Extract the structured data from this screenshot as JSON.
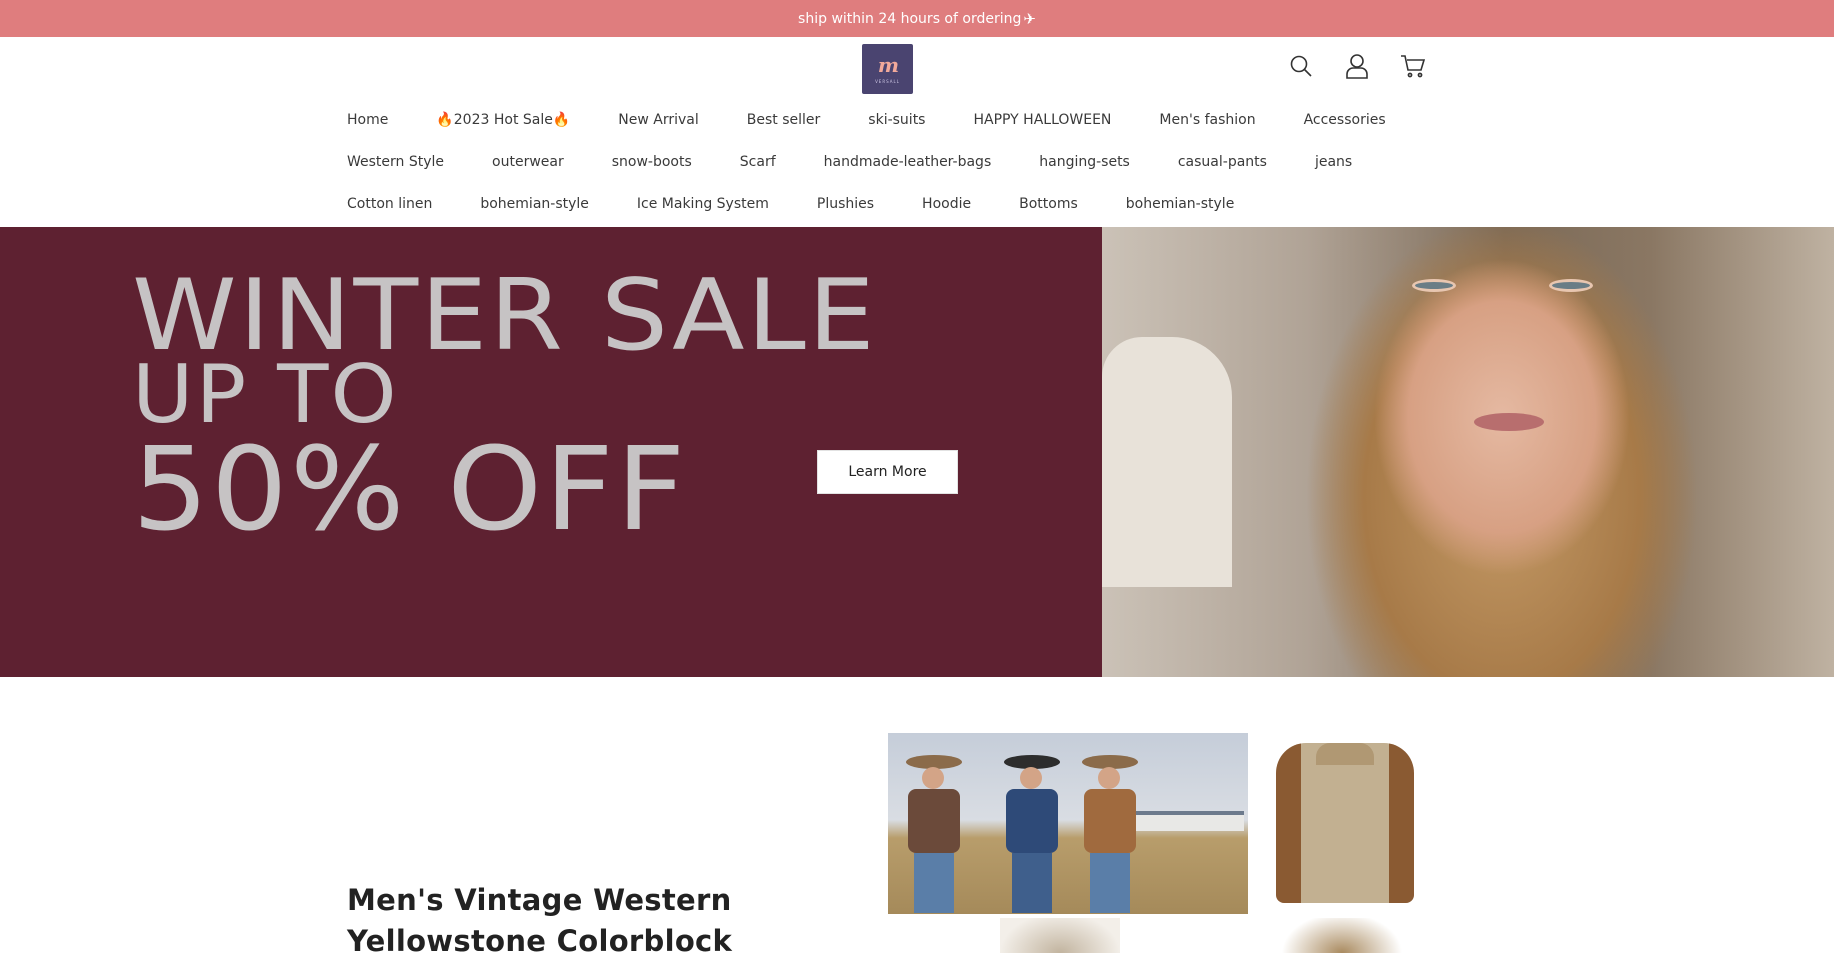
{
  "announcement": {
    "text": "ship within 24 hours of ordering",
    "icon": "✈"
  },
  "logo": {
    "mark": "m",
    "small_text": "VERSALL"
  },
  "header_icons": [
    "search-icon",
    "account-icon",
    "cart-icon"
  ],
  "nav": {
    "row1": [
      "Home",
      "🔥2023 Hot Sale🔥",
      "New Arrival",
      "Best seller",
      "ski-suits",
      "HAPPY HALLOWEEN",
      "Men's fashion",
      "Accessories"
    ],
    "row2": [
      "Western Style",
      "outerwear",
      "snow-boots",
      "Scarf",
      "handmade-leather-bags",
      "hanging-sets",
      "casual-pants",
      "jeans"
    ],
    "row3": [
      "Cotton linen",
      "bohemian-style",
      "Ice Making System",
      "Plushies",
      "Hoodie",
      "Bottoms",
      "bohemian-style"
    ]
  },
  "hero": {
    "line1": "WINTER SALE",
    "line2": "UP TO",
    "line3": "50% OFF",
    "button": "Learn More",
    "bg_color": "#5e2131"
  },
  "product": {
    "title": "Men's Vintage Western Yellowstone Colorblock"
  },
  "colors": {
    "announcement_bg": "#df7d7e",
    "hero_bg": "#5e2131",
    "logo_bg": "#4a4470"
  }
}
